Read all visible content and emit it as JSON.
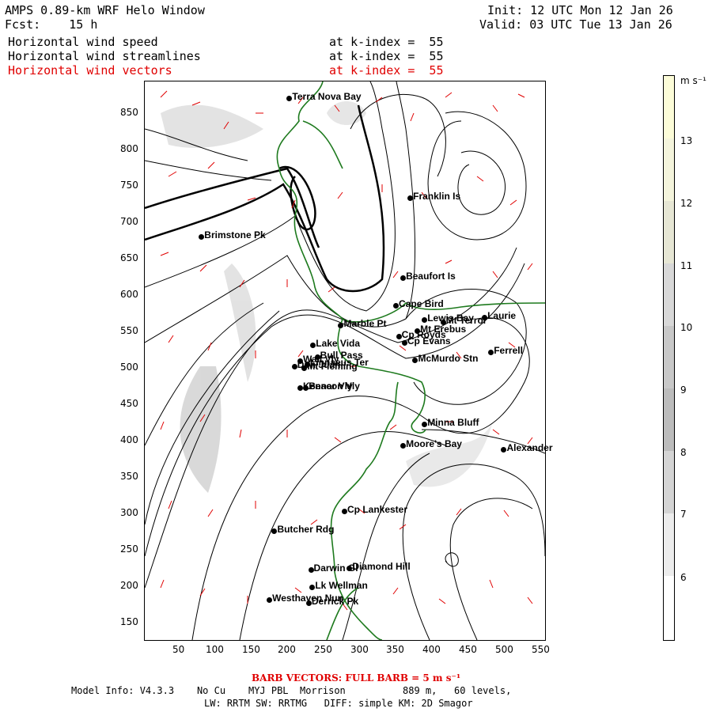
{
  "header": {
    "title": "AMPS 0.89-km WRF Helo Window",
    "forecast": "Fcst:    15 h",
    "init": "Init: 12 UTC Mon 12 Jan 26",
    "valid": "Valid: 03 UTC Tue 13 Jan 26",
    "fields": [
      {
        "name": "Horizontal wind speed",
        "level": "at k-index =  55",
        "color": "#000000"
      },
      {
        "name": "Horizontal wind streamlines",
        "level": "at k-index =  55",
        "color": "#000000"
      },
      {
        "name": "Horizontal wind vectors",
        "level": "at k-index =  55",
        "color": "#e00000"
      }
    ]
  },
  "axes": {
    "x_ticks": [
      "50",
      "100",
      "150",
      "200",
      "250",
      "300",
      "350",
      "400",
      "450",
      "500",
      "550"
    ],
    "y_ticks": [
      "850",
      "800",
      "750",
      "700",
      "650",
      "600",
      "550",
      "500",
      "450",
      "400",
      "350",
      "300",
      "250",
      "200",
      "150"
    ],
    "x_values": [
      50,
      100,
      150,
      200,
      250,
      300,
      350,
      400,
      450,
      500,
      550
    ],
    "y_values": [
      850,
      800,
      750,
      700,
      650,
      600,
      550,
      500,
      450,
      400,
      350,
      300,
      250,
      200,
      150
    ],
    "x_range": [
      0,
      560
    ],
    "y_range": [
      125,
      890
    ]
  },
  "places": [
    {
      "name": "Terra Nova Bay",
      "x": 203,
      "y": 866
    },
    {
      "name": "Franklin Is",
      "x": 372,
      "y": 730
    },
    {
      "name": "Brimstone Pk",
      "x": 80,
      "y": 677
    },
    {
      "name": "Beaufort Is",
      "x": 362,
      "y": 620
    },
    {
      "name": "Cape Bird",
      "x": 352,
      "y": 582
    },
    {
      "name": "Lewis Bay",
      "x": 392,
      "y": 563
    },
    {
      "name": "Laurie",
      "x": 476,
      "y": 566
    },
    {
      "name": "Mt Terror",
      "x": 418,
      "y": 560
    },
    {
      "name": "Marble Pt",
      "x": 275,
      "y": 555
    },
    {
      "name": "Cp Royds",
      "x": 356,
      "y": 540
    },
    {
      "name": "Mt Erebus",
      "x": 382,
      "y": 548
    },
    {
      "name": "Lake Vida",
      "x": 236,
      "y": 528
    },
    {
      "name": "Cp Evans",
      "x": 364,
      "y": 531
    },
    {
      "name": "Ferrell",
      "x": 485,
      "y": 518
    },
    {
      "name": "Wall Vly",
      "x": 218,
      "y": 506
    },
    {
      "name": "Bull Pass",
      "x": 242,
      "y": 512
    },
    {
      "name": "McMurdo Stn",
      "x": 379,
      "y": 507
    },
    {
      "name": "Don Juan",
      "x": 210,
      "y": 499
    },
    {
      "name": "Mt Fleming",
      "x": 224,
      "y": 497
    },
    {
      "name": "Linnaeus Ter",
      "x": 228,
      "y": 502
    },
    {
      "name": "Kennar Vly",
      "x": 218,
      "y": 470
    },
    {
      "name": "Beacon Vly",
      "x": 226,
      "y": 470
    },
    {
      "name": "Minna Bluff",
      "x": 392,
      "y": 420
    },
    {
      "name": "Moore's Bay",
      "x": 362,
      "y": 390
    },
    {
      "name": "Alexander",
      "x": 503,
      "y": 385
    },
    {
      "name": "Cp Lankester",
      "x": 280,
      "y": 300
    },
    {
      "name": "Butcher Rdg",
      "x": 182,
      "y": 273
    },
    {
      "name": "Diamond Hill",
      "x": 287,
      "y": 223
    },
    {
      "name": "Darwin Gl",
      "x": 233,
      "y": 220
    },
    {
      "name": "Lk Wellman",
      "x": 235,
      "y": 196
    },
    {
      "name": "Westhaven Nun",
      "x": 175,
      "y": 179
    },
    {
      "name": "Derrick Pk",
      "x": 230,
      "y": 175
    }
  ],
  "colorbar": {
    "unit": "m s⁻¹",
    "labels": [
      "13",
      "12",
      "11",
      "10",
      "9",
      "8",
      "7",
      "6"
    ],
    "levels": [
      13,
      12,
      11,
      10,
      9,
      8,
      7,
      6
    ],
    "colors": [
      "#fcfcd8",
      "#f4f4dc",
      "#e6e6d4",
      "#d8d8d8",
      "#c8c8c8",
      "#bcbcbc",
      "#d4d4d4",
      "#ececec",
      "#ffffff"
    ]
  },
  "footer": {
    "barb_note": "BARB VECTORS:  FULL BARB = 5 m s⁻¹",
    "model_info_1": "Model Info: V4.3.3    No Cu    MYJ PBL  Morrison          889 m,   60 levels,",
    "model_info_2": "LW: RRTM SW: RRTMG   DIFF: simple KM: 2D Smagor"
  }
}
